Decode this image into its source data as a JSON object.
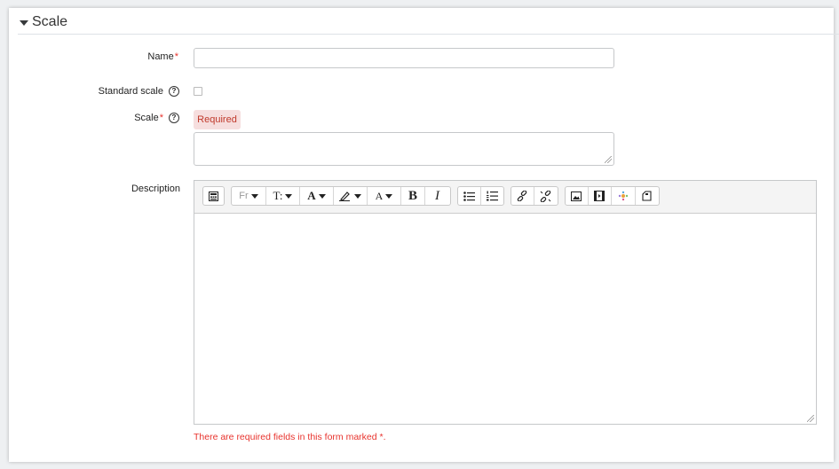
{
  "section": {
    "title": "Scale"
  },
  "fields": {
    "name": {
      "label": "Name",
      "required_marker": "*",
      "value": ""
    },
    "standard_scale": {
      "label": "Standard scale",
      "checked": false
    },
    "scale": {
      "label": "Scale",
      "required_marker": "*",
      "error_badge": "Required",
      "value": ""
    },
    "description": {
      "label": "Description",
      "value": ""
    }
  },
  "toolbar": {
    "groups": [
      [
        "show-more-buttons-icon"
      ],
      [
        "font-family-icon",
        "font-size-icon",
        "font-color-icon",
        "background-color-icon",
        "styles-icon",
        "bold-icon",
        "italic-icon"
      ],
      [
        "unordered-list-icon",
        "ordered-list-icon"
      ],
      [
        "link-icon",
        "unlink-icon"
      ],
      [
        "image-icon",
        "media-icon",
        "manage-files-icon",
        "h5p-icon"
      ]
    ],
    "font_family_label": "Fr",
    "font_size_label": "T:",
    "font_color_label": "A",
    "styles_label": "A",
    "bold_label": "B",
    "italic_label": "I"
  },
  "footer": {
    "required_note": "There are required fields in this form marked",
    "marker": "*."
  },
  "colors": {
    "required": "#e8332d",
    "error_bg": "#f6dede"
  }
}
